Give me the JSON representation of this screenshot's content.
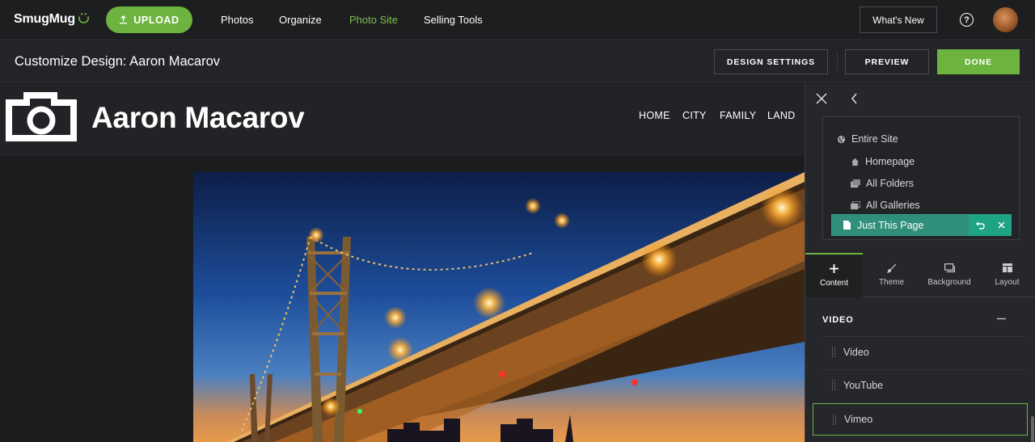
{
  "topbar": {
    "logo": "SmugMug",
    "upload_label": "UPLOAD",
    "nav": [
      "Photos",
      "Organize",
      "Photo Site",
      "Selling Tools"
    ],
    "active_nav": "Photo Site",
    "whats_new": "What's New",
    "help_glyph": "?"
  },
  "subbar": {
    "title": "Customize Design: Aaron Macarov",
    "design_settings": "DESIGN SETTINGS",
    "preview": "PREVIEW",
    "done": "DONE"
  },
  "site": {
    "name": "Aaron Macarov",
    "nav": [
      "HOME",
      "CITY",
      "FAMILY",
      "LAND"
    ]
  },
  "panel": {
    "scope": {
      "entire_site": "Entire Site",
      "homepage": "Homepage",
      "all_folders": "All Folders",
      "all_galleries": "All Galleries",
      "just_this_page": "Just This Page"
    },
    "tabs": [
      {
        "label": "Content",
        "icon": "plus-icon"
      },
      {
        "label": "Theme",
        "icon": "brush-icon"
      },
      {
        "label": "Background",
        "icon": "window-icon"
      },
      {
        "label": "Layout",
        "icon": "layout-icon"
      }
    ],
    "active_tab": "Content",
    "section": {
      "title": "VIDEO",
      "items": [
        "Video",
        "YouTube",
        "Vimeo"
      ]
    }
  },
  "colors": {
    "accent_green": "#6db33f",
    "scope_active": "#2f8f7a",
    "background": "#1d1e20"
  }
}
